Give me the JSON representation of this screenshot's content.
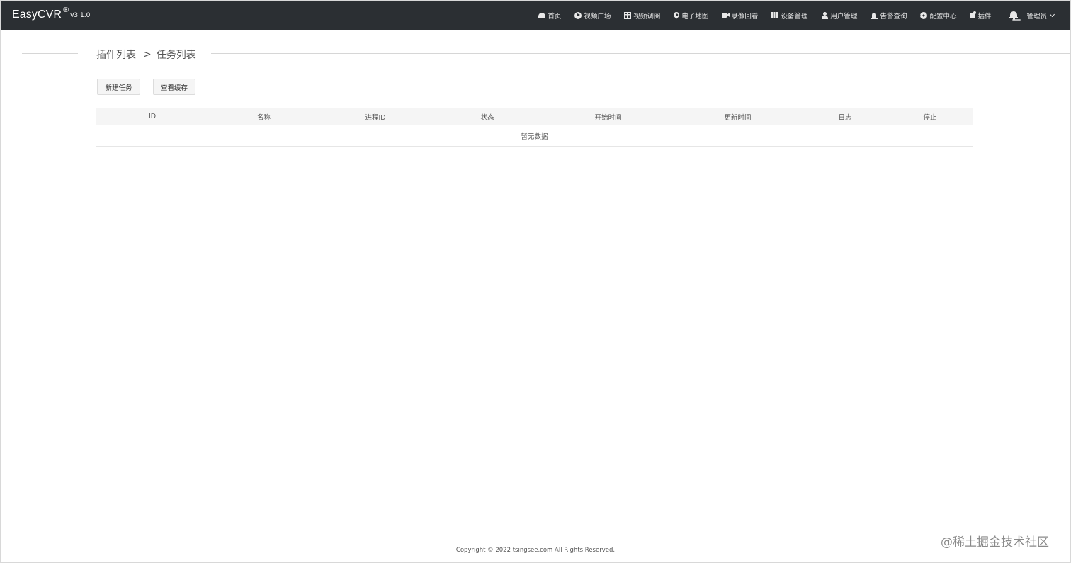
{
  "brand": {
    "name": "EasyCVR",
    "reg": "®",
    "version": "v3.1.0"
  },
  "nav": {
    "items": [
      {
        "label": "首页",
        "icon": "dashboard-icon"
      },
      {
        "label": "视频广场",
        "icon": "play-circle-icon"
      },
      {
        "label": "视频调阅",
        "icon": "table-icon"
      },
      {
        "label": "电子地图",
        "icon": "map-pin-icon"
      },
      {
        "label": "录像回看",
        "icon": "video-camera-icon"
      },
      {
        "label": "设备管理",
        "icon": "columns-icon"
      },
      {
        "label": "用户管理",
        "icon": "user-icon"
      },
      {
        "label": "告警查询",
        "icon": "alarm-icon"
      },
      {
        "label": "配置中心",
        "icon": "gear-icon"
      },
      {
        "label": "插件",
        "icon": "puzzle-icon"
      }
    ],
    "user": "管理员"
  },
  "breadcrumb": {
    "parent": "插件列表",
    "separator": ">",
    "current": "任务列表"
  },
  "toolbar": {
    "new_task": "新建任务",
    "view_cache": "查看缓存"
  },
  "table": {
    "columns": [
      "ID",
      "名称",
      "进程ID",
      "状态",
      "开始时间",
      "更新时间",
      "日志",
      "停止"
    ],
    "empty_text": "暂无数据"
  },
  "footer": {
    "copyright": "Copyright © 2022 tsingsee.com All Rights Reserved."
  },
  "watermark": "@稀土掘金技术社区",
  "colors": {
    "navbar": "#2b2f33",
    "header_bg": "#f5f5f5"
  }
}
